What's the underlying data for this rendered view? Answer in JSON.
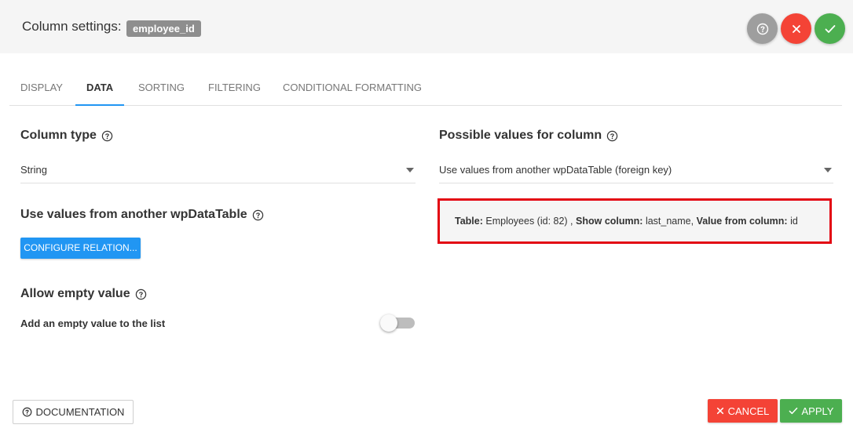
{
  "header": {
    "title": "Column settings:",
    "column_name": "employee_id",
    "colors": {
      "help": "#9e9e9e",
      "close": "#f44336",
      "confirm": "#4caf50"
    }
  },
  "tabs": [
    {
      "label": "DISPLAY",
      "active": false
    },
    {
      "label": "DATA",
      "active": true
    },
    {
      "label": "SORTING",
      "active": false
    },
    {
      "label": "FILTERING",
      "active": false
    },
    {
      "label": "CONDITIONAL FORMATTING",
      "active": false
    }
  ],
  "left": {
    "column_type": {
      "title": "Column type",
      "value": "String"
    },
    "foreign": {
      "title": "Use values from another wpDataTable",
      "button": "CONFIGURE RELATION..."
    },
    "empty": {
      "title": "Allow empty value",
      "label": "Add an empty value to the list",
      "enabled": false
    }
  },
  "right": {
    "possible": {
      "title": "Possible values for column",
      "value": "Use values from another wpDataTable (foreign key)"
    },
    "relation": {
      "table_label": "Table:",
      "table_value": "Employees (id: 82) ,",
      "show_label": "Show column:",
      "show_value": "last_name,",
      "value_label": "Value from column:",
      "value_value": "id"
    }
  },
  "footer": {
    "documentation": "DOCUMENTATION",
    "cancel": "CANCEL",
    "apply": "APPLY"
  }
}
